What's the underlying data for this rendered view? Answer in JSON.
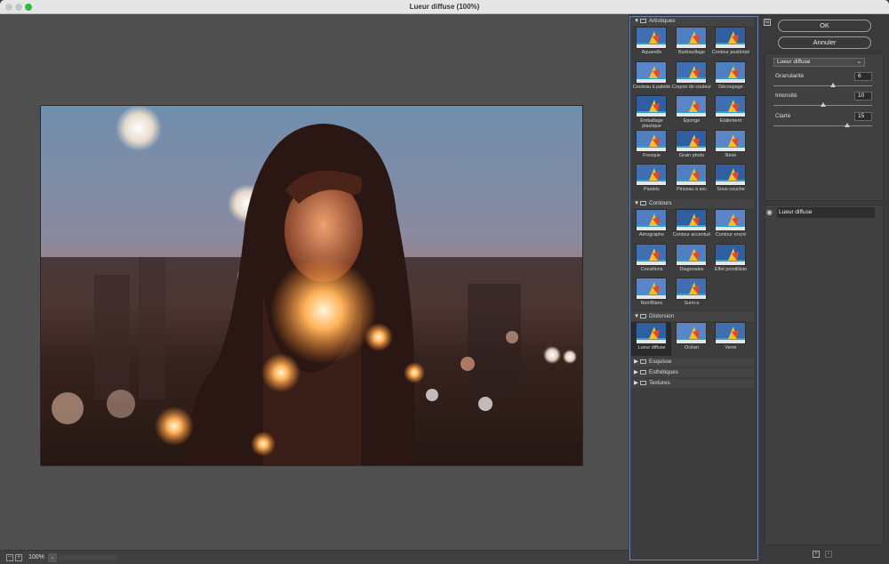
{
  "window": {
    "title": "Lueur diffuse (100%)"
  },
  "canvas": {
    "zoom": "100%",
    "zoom_dropdown": "⌄"
  },
  "gallery": {
    "categories": [
      {
        "name": "Artistiques",
        "expanded": true,
        "filters": [
          "Aquarelle",
          "Barbouillage",
          "Contour postérisé",
          "Couteau à palette",
          "Crayon de couleur",
          "Découpage",
          "Emballage plastique",
          "Eponge",
          "Etalement",
          "Fresque",
          "Grain photo",
          "Néon",
          "Pastels",
          "Pinceau à sec",
          "Sous-couche"
        ]
      },
      {
        "name": "Contours",
        "expanded": true,
        "filters": [
          "Aérographe",
          "Contour accentué",
          "Contour encré",
          "Croisillons",
          "Diagonales",
          "Effet pointilliste",
          "Noir/Blanc",
          "Sumi-e"
        ]
      },
      {
        "name": "Distorsion",
        "expanded": true,
        "filters": [
          "Lueur diffuse",
          "Océan",
          "Verre"
        ]
      },
      {
        "name": "Esquisse",
        "expanded": false,
        "filters": []
      },
      {
        "name": "Esthétiques",
        "expanded": false,
        "filters": []
      },
      {
        "name": "Textures",
        "expanded": false,
        "filters": []
      }
    ],
    "selected": "Lueur diffuse"
  },
  "dialog": {
    "ok_label": "OK",
    "cancel_label": "Annuler",
    "filter_select": "Lueur diffuse",
    "params": [
      {
        "label": "Granularité",
        "value": "6",
        "fraction": 0.6
      },
      {
        "label": "Intensité",
        "value": "10",
        "fraction": 0.5
      },
      {
        "label": "Clarté",
        "value": "15",
        "fraction": 0.75
      }
    ]
  },
  "layers": {
    "items": [
      "Lueur diffuse"
    ]
  },
  "colors": {
    "accent": "#6b86ad",
    "panel": "#3d3d3d",
    "canvas": "#505050"
  }
}
